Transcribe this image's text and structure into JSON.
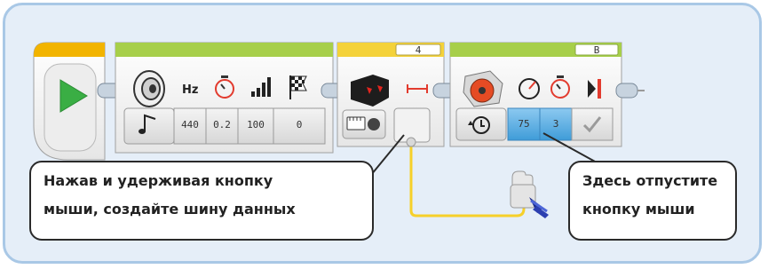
{
  "blocks": {
    "sound": {
      "inputs": [
        {
          "icon": "frequency-hz-icon",
          "icon_text": "Hz",
          "value": "440"
        },
        {
          "icon": "duration-stopwatch-icon",
          "value": "0.2"
        },
        {
          "icon": "volume-bars-icon",
          "value": "100"
        },
        {
          "icon": "play-type-flag-icon",
          "value": "0"
        }
      ]
    },
    "sensor": {
      "port": "4"
    },
    "motor": {
      "port": "B",
      "inputs": [
        {
          "icon": "speed-gauge-icon",
          "value": "75"
        },
        {
          "icon": "seconds-stopwatch-icon",
          "value": "3"
        },
        {
          "icon": "brake-icon",
          "value": ""
        }
      ]
    }
  },
  "callouts": {
    "left": {
      "line1": "Нажав и удерживая кнопку",
      "line2": "мыши, создайте шину данных"
    },
    "right": {
      "line1": "Здесь отпустите",
      "line2": "кнопку мыши"
    }
  },
  "colors": {
    "start_bar": "#f2b400",
    "green_bar": "#a7cf4a",
    "yellow_bar": "#f4d23a",
    "data_wire": "#f6d02a",
    "selected_input": "#4aa3df"
  }
}
